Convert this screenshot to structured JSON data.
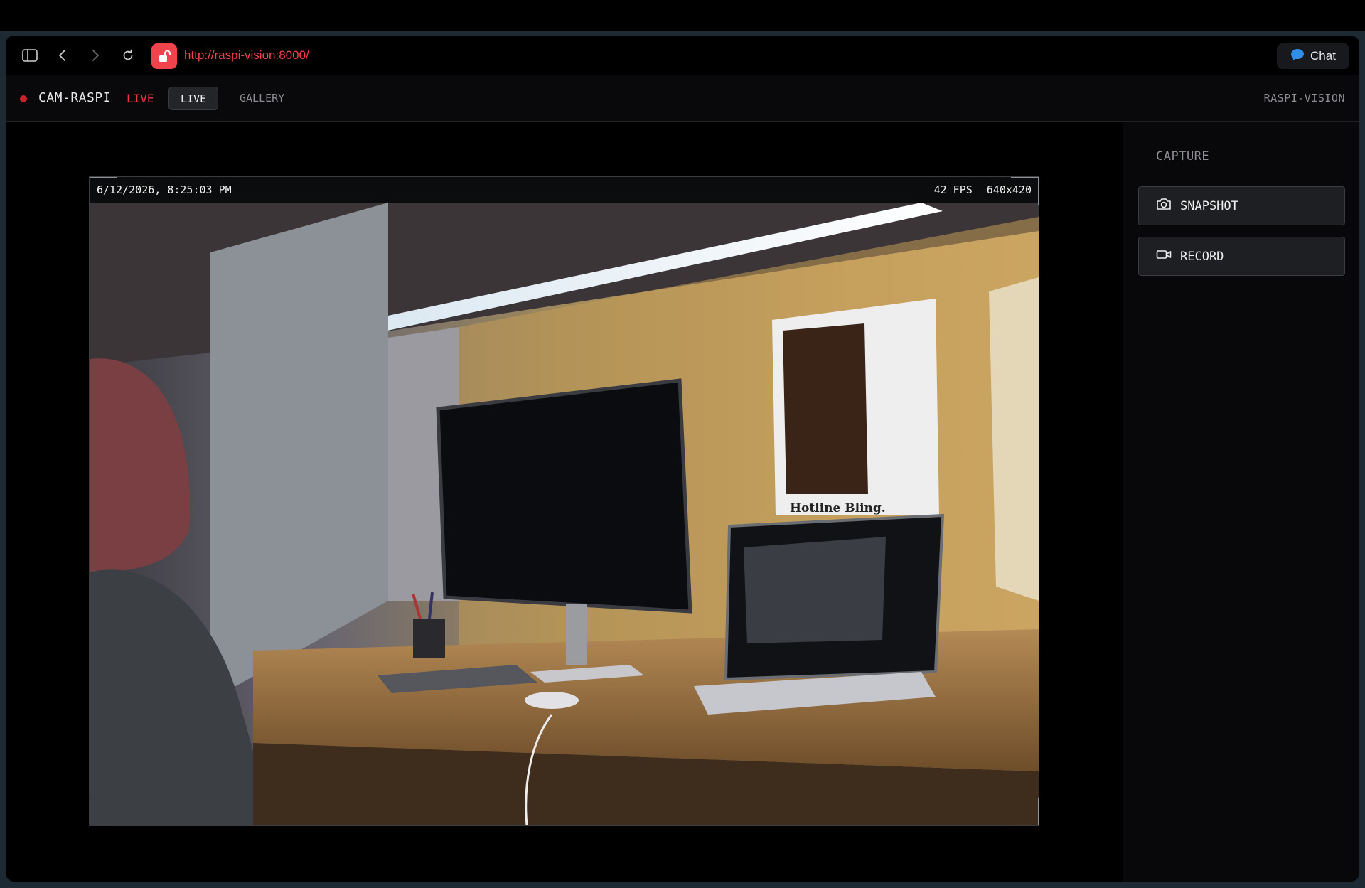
{
  "browser": {
    "url": "http://raspi-vision:8000/",
    "chat_label": "Chat",
    "icons": [
      "sidebar-toggle-icon",
      "back-arrow-icon",
      "forward-arrow-icon",
      "reload-icon",
      "unlocked-padlock-icon",
      "chat-bubble-icon"
    ]
  },
  "header": {
    "camera_name": "CAM-RASPI",
    "live_indicator": "LIVE",
    "tabs": [
      {
        "label": "LIVE",
        "active": true
      },
      {
        "label": "GALLERY",
        "active": false
      }
    ],
    "brand": "RASPI-VISION"
  },
  "feed": {
    "timestamp": "6/12/2026, 8:25:03 PM",
    "fps": "42 FPS",
    "resolution": "640x420",
    "poster_caption": "Hotline Bling."
  },
  "capture_panel": {
    "title": "CAPTURE",
    "snapshot_label": "SNAPSHOT",
    "record_label": "RECORD",
    "icons": [
      "camera-icon",
      "video-camera-icon"
    ]
  },
  "colors": {
    "accent_red": "#f0434b",
    "live_red": "#ef3a42",
    "chat_blue": "#2f8fe8"
  }
}
